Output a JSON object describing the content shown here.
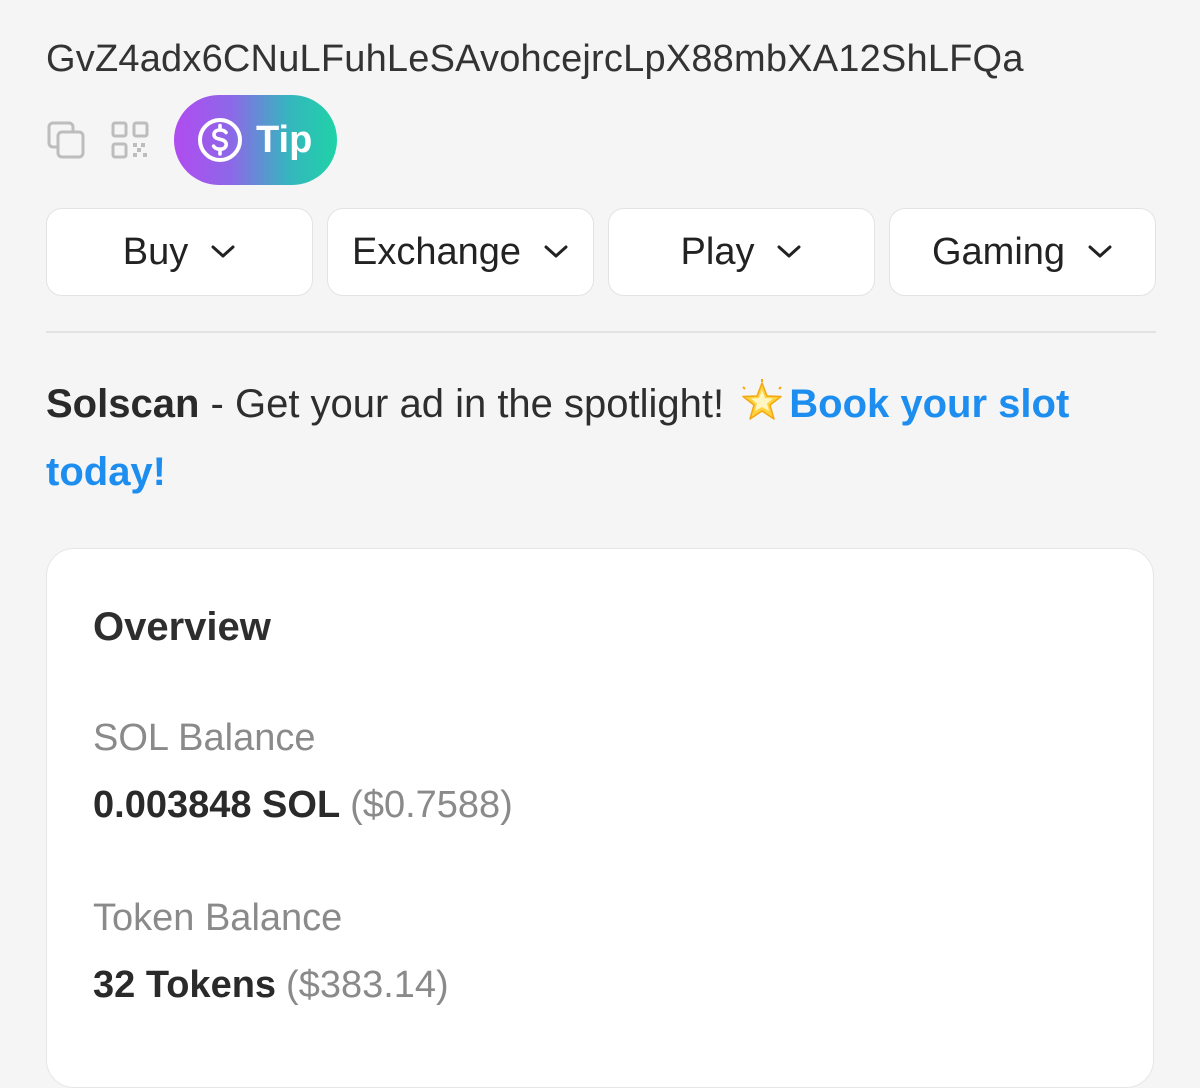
{
  "account": {
    "address": "GvZ4adx6CNuLFuhLeSAvohcejrcLpX88mbXA12ShLFQa"
  },
  "actions": {
    "copy_icon": "copy-icon",
    "qr_icon": "qr-code-icon",
    "tip_label": "Tip",
    "tip_icon": "dollar-coin-icon",
    "tip_gradient": [
      "#b14bf0",
      "#1fd3a6"
    ]
  },
  "nav": [
    {
      "label": "Buy"
    },
    {
      "label": "Exchange"
    },
    {
      "label": "Play"
    },
    {
      "label": "Gaming"
    }
  ],
  "ad": {
    "brand": "Solscan",
    "message": " - Get your ad in the spotlight! ",
    "link_text": "Book your slot today!",
    "link_color": "#1d8ef0",
    "emoji_icon": "glowing-star-icon"
  },
  "overview": {
    "title": "Overview",
    "sol_balance": {
      "label": "SOL Balance",
      "amount": "0.003848 SOL",
      "usd": "($0.7588)"
    },
    "token_balance": {
      "label": "Token Balance",
      "amount": "32 Tokens",
      "usd": "($383.14)"
    }
  }
}
